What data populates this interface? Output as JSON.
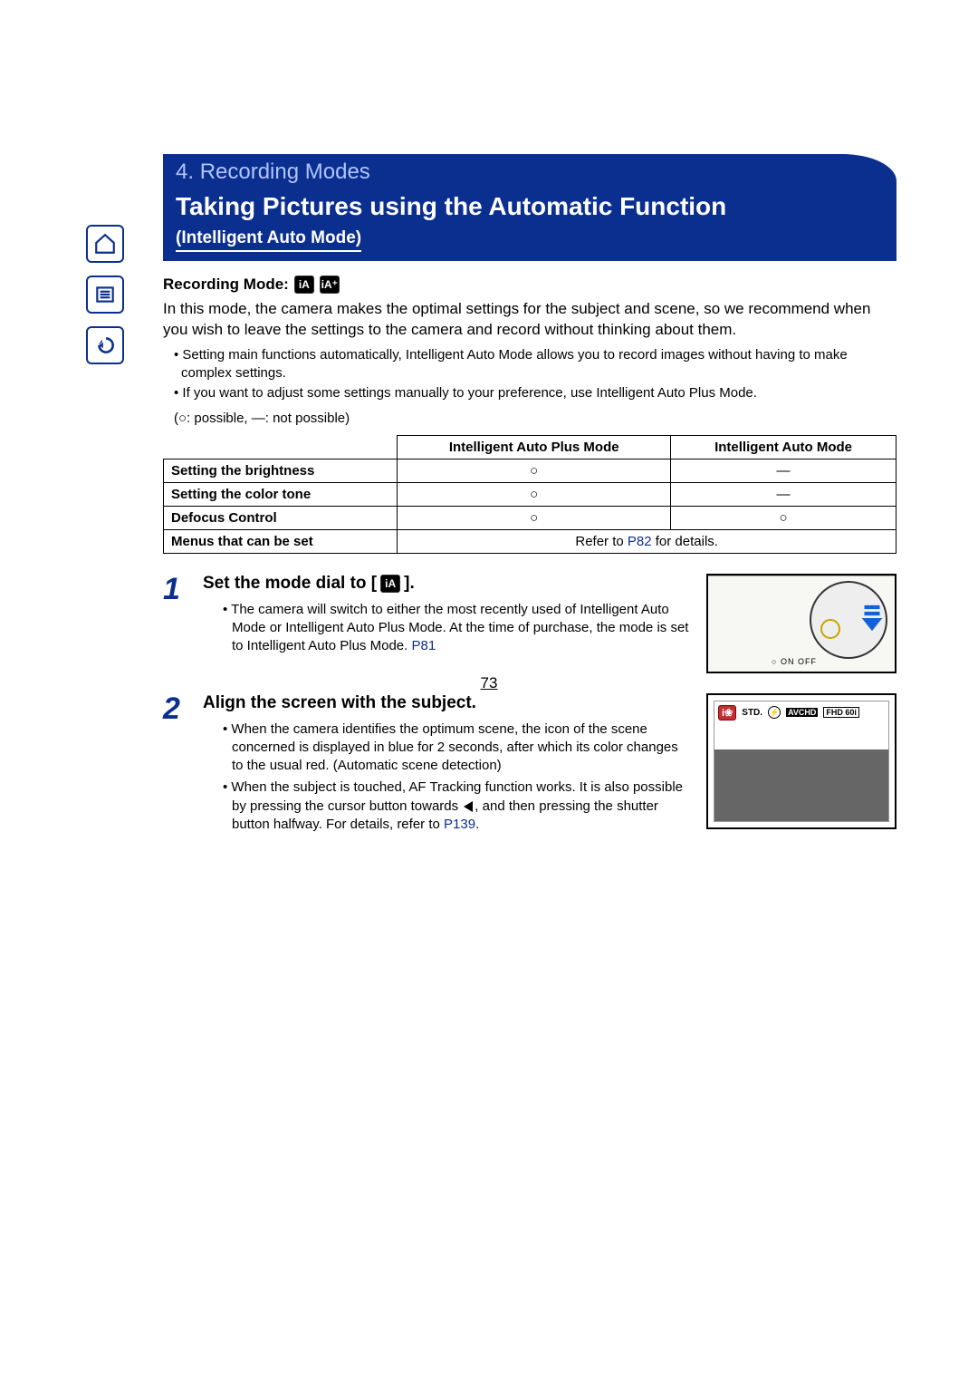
{
  "chapter": {
    "number": "4.",
    "title": "Recording Modes"
  },
  "page_title": "Taking Pictures using the Automatic Function",
  "subtitle": "(Intelligent Auto Mode)",
  "recording_mode_label": "Recording Mode:",
  "intro": "In this mode, the camera makes the optimal settings for the subject and scene, so we recommend when you wish to leave the settings to the camera and record without thinking about them.",
  "notes": [
    "Setting main functions automatically, Intelligent Auto Mode allows you to record images without having to make complex settings.",
    "If you want to adjust some settings manually to your preference, use Intelligent Auto Plus Mode."
  ],
  "legend": "(○: possible, ―: not possible)",
  "table": {
    "headers": [
      "",
      "Intelligent Auto Plus Mode",
      "Intelligent Auto Mode"
    ],
    "rows": [
      {
        "label": "Setting the brightness",
        "c1": "○",
        "c2": "―"
      },
      {
        "label": "Setting the color tone",
        "c1": "○",
        "c2": "―"
      },
      {
        "label": "Defocus Control",
        "c1": "○",
        "c2": "○"
      }
    ],
    "menus_label": "Menus that can be set",
    "menus_value_prefix": "Refer to ",
    "menus_link": "P82",
    "menus_value_suffix": " for details."
  },
  "steps": [
    {
      "num": "1",
      "title_before": "Set the mode dial to [",
      "title_after": "].",
      "bullets": [
        {
          "text": "The camera will switch to either the most recently used of Intelligent Auto Mode or Intelligent Auto Plus Mode. At the time of purchase, the mode is set to Intelligent Auto Plus Mode. ",
          "link": "P81"
        }
      ],
      "illus_onoff": "ON  OFF"
    },
    {
      "num": "2",
      "title": "Align the screen with the subject.",
      "bullets": [
        {
          "text": "When the camera identifies the optimum scene, the icon of the scene concerned is displayed in blue for 2 seconds, after which its color changes to the usual red. (Automatic scene detection)"
        },
        {
          "text_before": "When the subject is touched, AF Tracking function works. It is also possible by pressing the cursor button towards ",
          "has_tri": true,
          "text_after": ", and then pressing the shutter button halfway. For details, refer to ",
          "link": "P139",
          "tail": "."
        }
      ],
      "lcd": {
        "ia": "i",
        "std": "STD.",
        "avchd": "AVCHD",
        "fhd": "FHD 60i"
      }
    }
  ],
  "page_number": "73"
}
